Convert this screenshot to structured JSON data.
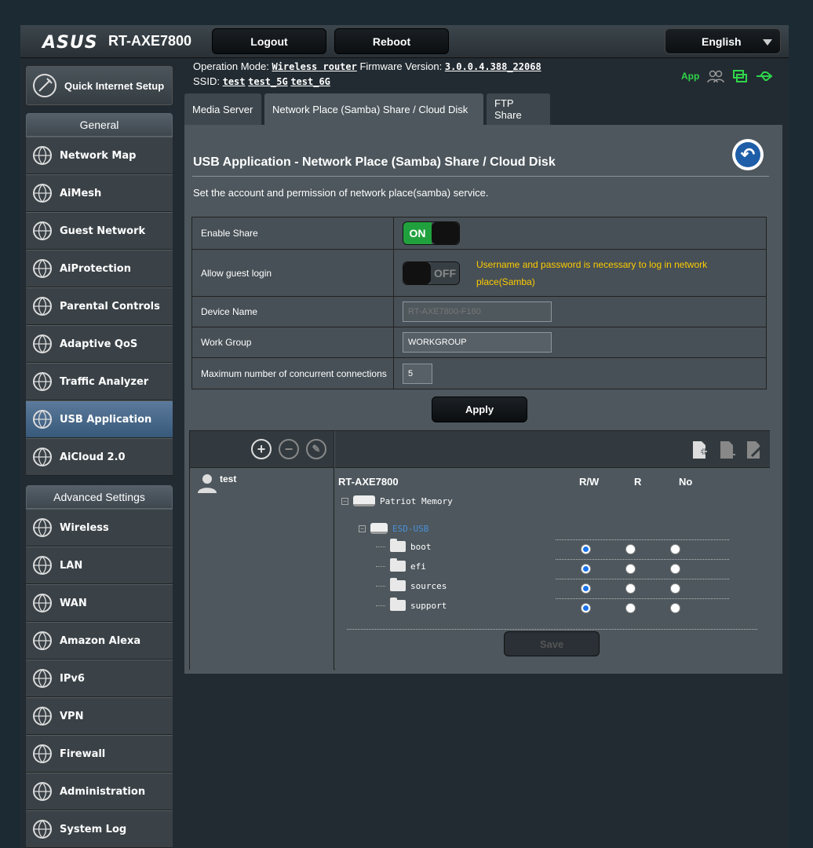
{
  "header": {
    "logo": "ASUS",
    "model": "RT-AXE7800",
    "logout_label": "Logout",
    "reboot_label": "Reboot",
    "language": "English"
  },
  "info": {
    "operation_mode_label": "Operation Mode:",
    "operation_mode": "Wireless router",
    "firmware_label": "Firmware Version:",
    "firmware": "3.0.0.4.388_22068",
    "ssid_label": "SSID:",
    "ssids": [
      "test",
      "test_5G",
      "test_6G"
    ],
    "app_label": "App"
  },
  "sidebar": {
    "qis_label": "Quick Internet Setup",
    "general_header": "General",
    "general_items": [
      {
        "label": "Network Map",
        "icon": "globe-icon"
      },
      {
        "label": "AiMesh",
        "icon": "mesh-icon"
      },
      {
        "label": "Guest Network",
        "icon": "guest-globe-icon"
      },
      {
        "label": "AiProtection",
        "icon": "shield-lock-icon"
      },
      {
        "label": "Parental Controls",
        "icon": "family-icon"
      },
      {
        "label": "Adaptive QoS",
        "icon": "speedometer-icon"
      },
      {
        "label": "Traffic Analyzer",
        "icon": "pulse-icon"
      },
      {
        "label": "USB Application",
        "icon": "usb-icon"
      },
      {
        "label": "AiCloud 2.0",
        "icon": "cloud-icon"
      }
    ],
    "advanced_header": "Advanced Settings",
    "advanced_items": [
      {
        "label": "Wireless",
        "icon": "wifi-icon"
      },
      {
        "label": "LAN",
        "icon": "lan-icon"
      },
      {
        "label": "WAN",
        "icon": "wan-globe-icon"
      },
      {
        "label": "Amazon Alexa",
        "icon": "alexa-icon"
      },
      {
        "label": "IPv6",
        "icon": "ipv6-icon"
      },
      {
        "label": "VPN",
        "icon": "vpn-icon"
      },
      {
        "label": "Firewall",
        "icon": "firewall-icon"
      },
      {
        "label": "Administration",
        "icon": "admin-gear-icon"
      },
      {
        "label": "System Log",
        "icon": "log-icon"
      }
    ]
  },
  "tabs": [
    "Media Server",
    "Network Place (Samba) Share / Cloud Disk",
    "FTP Share"
  ],
  "main": {
    "title": "USB Application - Network Place (Samba) Share / Cloud Disk",
    "description": "Set the account and permission of network place(samba) service.",
    "enable_share_label": "Enable Share",
    "enable_share_state": "ON",
    "guest_login_label": "Allow guest login",
    "guest_login_state": "OFF",
    "guest_warning": "Username and password is necessary to log in network place(Samba)",
    "device_name_label": "Device Name",
    "device_name_value": "RT-AXE7800-F180",
    "workgroup_label": "Work Group",
    "workgroup_value": "WORKGROUP",
    "max_conn_label": "Maximum number of concurrent connections",
    "max_conn_value": "5",
    "apply_label": "Apply"
  },
  "accounts": {
    "users": [
      "test"
    ]
  },
  "tree": {
    "root": "RT-AXE7800",
    "col_rw": "R/W",
    "col_r": "R",
    "col_no": "No",
    "disk": "Patriot Memory",
    "volume": "ESD-USB",
    "folders": [
      {
        "name": "boot",
        "permission": "R/W"
      },
      {
        "name": "efi",
        "permission": "R/W"
      },
      {
        "name": "sources",
        "permission": "R/W"
      },
      {
        "name": "support",
        "permission": "R/W"
      }
    ],
    "save_label": "Save"
  },
  "colors": {
    "accent_on": "#21a13e",
    "warning": "#ffcc00",
    "link_blue": "#4a90d9",
    "active_menu": "#37597a"
  }
}
